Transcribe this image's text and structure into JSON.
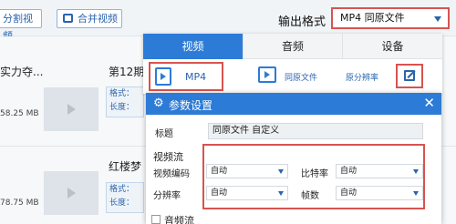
{
  "toolbar": {
    "split_label": "分割视频",
    "merge_label": "合并视频",
    "format_label": "输出格式",
    "format_value": "MP4  同原文件"
  },
  "files": [
    {
      "name_left": "实力夺...",
      "size": "58.25 MB",
      "name_right": "第12期",
      "meta": [
        "格式：",
        "长度："
      ]
    },
    {
      "name_right": "红楼梦",
      "size": "78.75 MB",
      "meta": [
        "格式：",
        "长度："
      ]
    }
  ],
  "format_panel": {
    "tabs": [
      "视频",
      "音频",
      "设备"
    ],
    "selected_format": "MP4",
    "quality_same": "同原文件",
    "quality_resolution": "原分辨率"
  },
  "dialog": {
    "title": "参数设置",
    "close": "✕",
    "name_label": "标题",
    "name_value": "同原文件 自定义",
    "video_section": "视频流",
    "codec_label": "视频编码",
    "codec_value": "自动",
    "bitrate_label": "比特率",
    "bitrate_value": "自动",
    "resolution_label": "分辨率",
    "resolution_value": "自动",
    "fps_label": "帧数",
    "fps_value": "自动",
    "audio_section": "音频流"
  },
  "colors": {
    "accent": "#2c7bd6",
    "highlight": "#d9534f"
  }
}
